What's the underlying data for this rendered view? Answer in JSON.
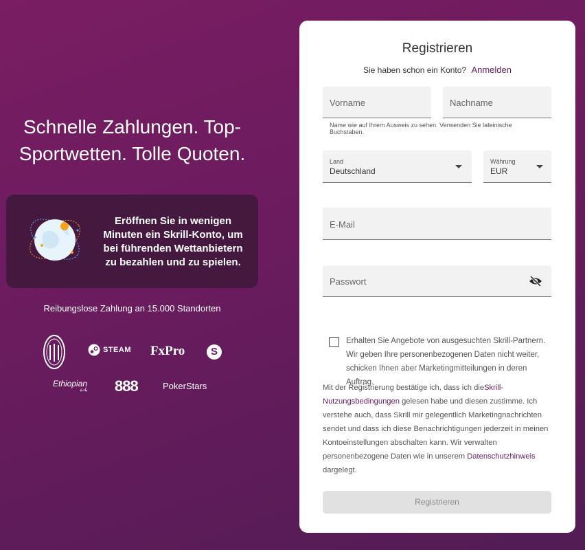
{
  "hero": {
    "title": "Schnelle Zahlungen. Top-Sportwetten. Tolle Quoten."
  },
  "promo": {
    "text": "Eröffnen Sie in wenigen Minuten ein Skrill-Konto, um bei führenden Wettanbietern zu bezahlen und zu spielen.",
    "icon": "globe-icon"
  },
  "locations": "Reibungslose Zahlung an 15.000 Standorten",
  "logos": {
    "steam": "STEAM",
    "fxpro": "FxPro",
    "skype": "S",
    "ethiopian": "Ethiopian",
    "ethiopian_sub": "يادة",
    "eight": "888",
    "pokerstars": "PokerStars"
  },
  "form": {
    "title": "Registrieren",
    "have_account": "Sie haben schon ein Konto?",
    "login_link": "Anmelden",
    "first_name_placeholder": "Vorname",
    "last_name_placeholder": "Nachname",
    "name_hint": "Name wie auf Ihrem Ausweis zu sehen. Verwenden Sie lateinische Buchstaben.",
    "country_label": "Land",
    "country_value": "Deutschland",
    "currency_label": "Währung",
    "currency_value": "EUR",
    "email_placeholder": "E-Mail",
    "password_placeholder": "Passwort",
    "consent_text": "Erhalten Sie Angebote von ausgesuchten Skrill-Partnern. Wir geben Ihre personenbezogenen Daten nicht weiter, schicken Ihnen aber Marketingmitteilungen in deren Auftrag.",
    "legal_part1": "Mit der Registrierung bestätige ich, dass ich die",
    "legal_link1": "Skrill-Nutzungsbedingungen",
    "legal_part2": " gelesen habe und diesen zustimme. Ich verstehe auch, dass Skrill mir gelegentlich Marketingnachrichten sendet und dass ich diese Benachrichtigungen jederzeit in meinen Kontoeinstellungen abschalten kann. Wir verwalten personenbezogene Daten wie in unserem ",
    "legal_link2": "Datenschutzhinweis",
    "legal_part3": " dargelegt.",
    "submit_label": "Registrieren"
  },
  "colors": {
    "brand": "#6a1c5e",
    "promo_bg": "#45193f",
    "button_disabled": "#e1e1e1"
  }
}
